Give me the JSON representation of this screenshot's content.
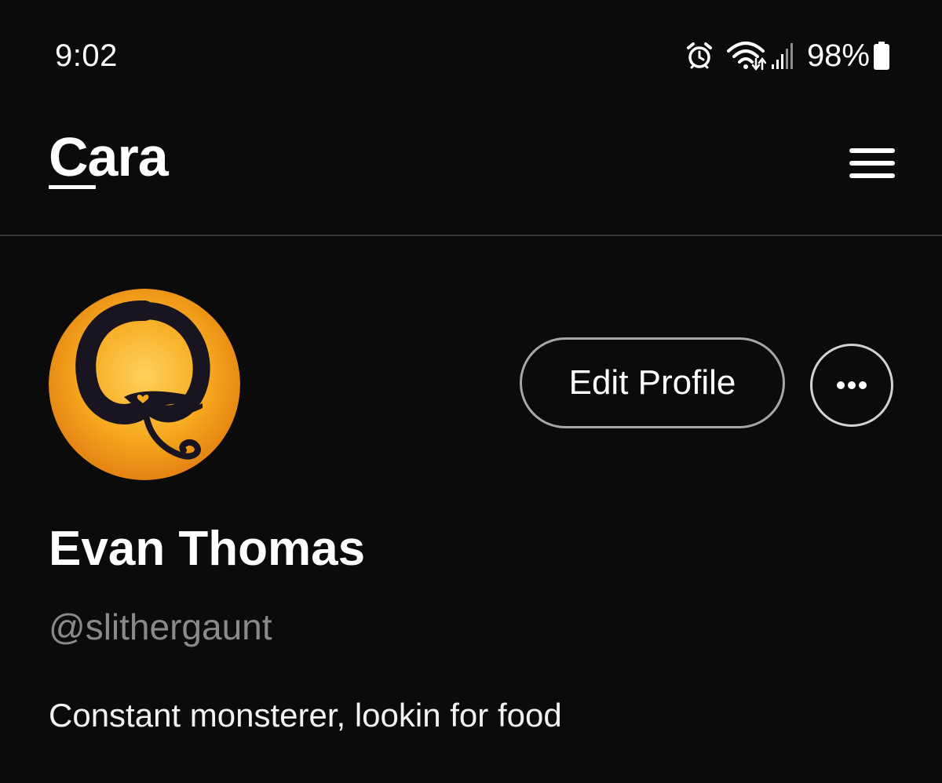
{
  "status_bar": {
    "time": "9:02",
    "icons": [
      "alarm-icon",
      "wifi-icon",
      "signal-icon",
      "battery-icon"
    ],
    "battery_percent": "98%"
  },
  "header": {
    "brand": "Cara",
    "menu_icon": "hamburger-menu-icon"
  },
  "profile": {
    "avatar_icon": "serpent-avatar-icon",
    "edit_button_label": "Edit Profile",
    "more_icon": "more-options-icon",
    "display_name": "Evan Thomas",
    "username": "@slithergaunt",
    "bio": "Constant monsterer, lookin for food"
  },
  "colors": {
    "background": "#0b0b0c",
    "text": "#ffffff",
    "muted_text": "#8a8a8e",
    "divider": "#3a3a3d",
    "button_border": "#a6a6ab",
    "avatar_orange": "#f2a21d"
  }
}
